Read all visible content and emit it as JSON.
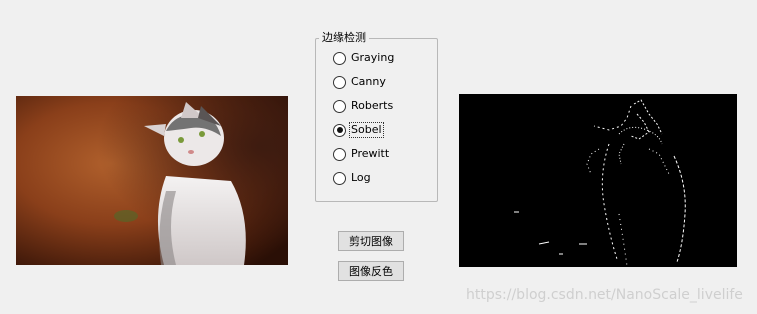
{
  "edge_group": {
    "title": "边缘检测",
    "options": [
      {
        "label": "Graying",
        "selected": false
      },
      {
        "label": "Canny",
        "selected": false
      },
      {
        "label": "Roberts",
        "selected": false
      },
      {
        "label": "Sobel",
        "selected": true
      },
      {
        "label": "Prewitt",
        "selected": false
      },
      {
        "label": "Log",
        "selected": false
      }
    ]
  },
  "buttons": {
    "cut": "剪切图像",
    "invert": "图像反色"
  },
  "watermark": "https://blog.csdn.net/NanoScale_livelife"
}
